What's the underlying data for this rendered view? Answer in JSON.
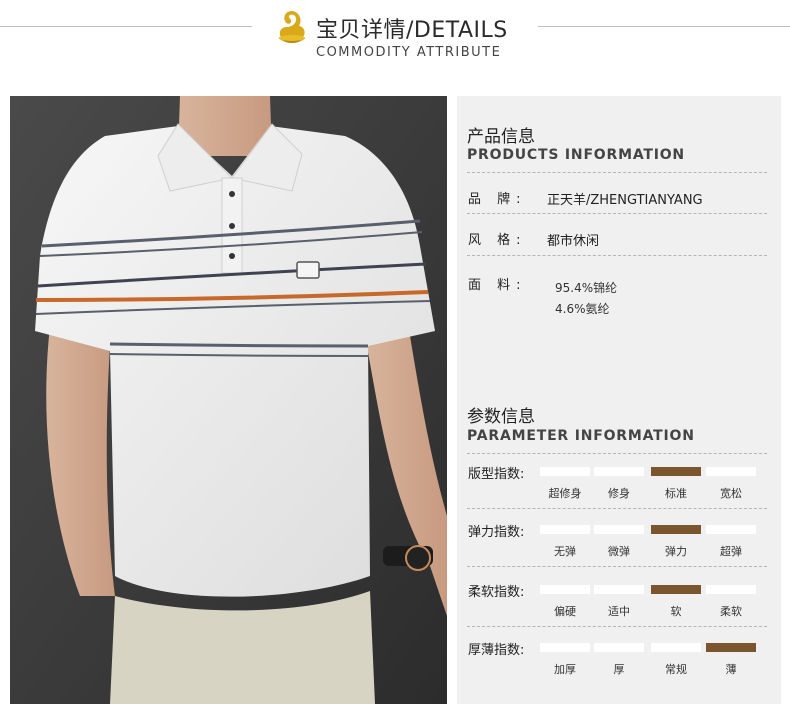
{
  "header": {
    "title": "宝贝详情/DETAILS",
    "subtitle": "COMMODITY ATTRIBUTE",
    "logo_icon": "gold-ingot-logo-icon"
  },
  "colors": {
    "panel_bg": "#f0f0f0",
    "active_bar": "#7a552d",
    "inactive_bar": "#ffffff",
    "logo_gold": "#d9a91a"
  },
  "products": {
    "title_cn": "产品信息",
    "title_en": "PRODUCTS INFORMATION",
    "brand": {
      "label": "品 牌:",
      "value": "正天羊/ZHENGTIANYANG"
    },
    "style": {
      "label": "风 格:",
      "value": "都市休闲"
    },
    "fabric": {
      "label": "面 料:",
      "line1": "95.4%锦纶",
      "line2": "4.6%氨纶"
    }
  },
  "parameters": {
    "title_cn": "参数信息",
    "title_en": "PARAMETER INFORMATION",
    "rows": [
      {
        "label": "版型指数:",
        "options": [
          "超修身",
          "修身",
          "标准",
          "宽松"
        ],
        "selected": 2
      },
      {
        "label": "弹力指数:",
        "options": [
          "无弹",
          "微弹",
          "弹力",
          "超弹"
        ],
        "selected": 2
      },
      {
        "label": "柔软指数:",
        "options": [
          "偏硬",
          "适中",
          "软",
          "柔软"
        ],
        "selected": 2
      },
      {
        "label": "厚薄指数:",
        "options": [
          "加厚",
          "厚",
          "常规",
          "薄"
        ],
        "selected": 3
      }
    ]
  }
}
